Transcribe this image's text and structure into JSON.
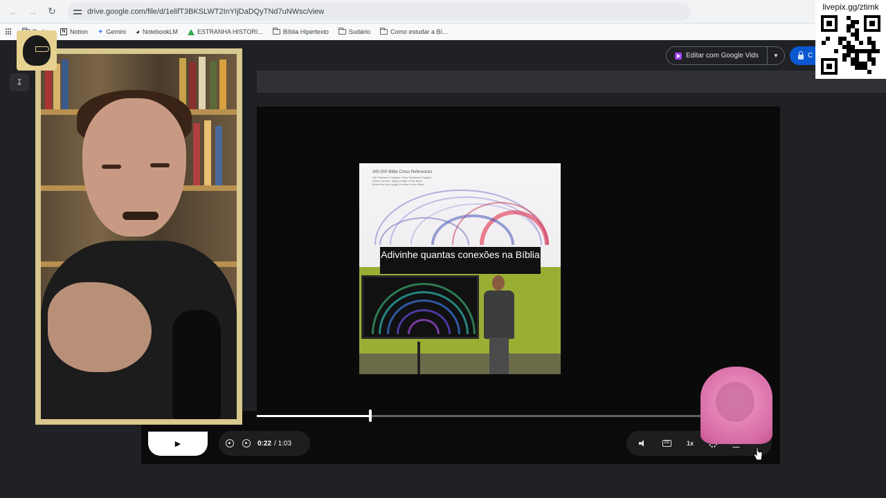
{
  "browser": {
    "url": "drive.google.com/file/d/1elifT3BKSLWT2InYIjDaDQyTNd7uNWsc/view",
    "bookmarks": [
      "Redes",
      "Notion",
      "Gemini",
      "NotebookLM",
      "ESTRANHA HISTORI...",
      "Bíblia Hipertexto",
      "Sudário",
      "Como estudar a Bí..."
    ]
  },
  "drive": {
    "vids_button": "Editar com Google Vids",
    "share_button": "C"
  },
  "video": {
    "caption": "Adivinhe quantas conexões na Bíblia",
    "frame_title": "340,000 Bible Cross References",
    "frame_subtitle_1": "Old Testament Targets / New Testament Targets",
    "frame_subtitle_2": "Above the line: target is later in the Bible",
    "frame_subtitle_3": "Below the line: target is earlier in the Bible",
    "current_time": "0:22",
    "duration": "/ 1:03",
    "progress": 0.2205,
    "speed": "1x"
  },
  "overlay": {
    "qr_label": "livepix.gg/ztimk"
  },
  "colors": {
    "drive_bg": "#202124",
    "accent_blue": "#0b57d0",
    "frame_gold": "#d9c88f"
  }
}
